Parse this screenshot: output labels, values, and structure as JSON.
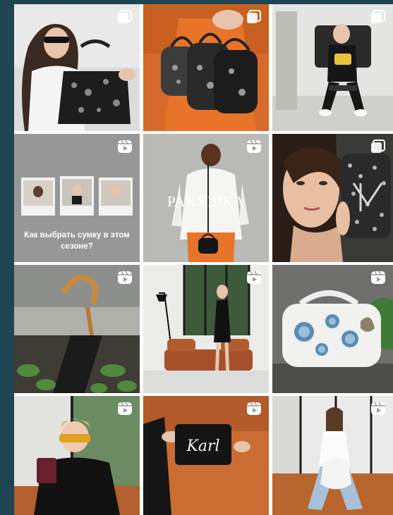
{
  "feed": {
    "tiles": [
      {
        "type": "carousel",
        "icon": "carousel-icon"
      },
      {
        "type": "carousel",
        "icon": "carousel-icon"
      },
      {
        "type": "carousel",
        "icon": "carousel-icon"
      },
      {
        "type": "reel",
        "icon": "reels-icon",
        "caption": "Как выбрать сумку в этом сезоне?"
      },
      {
        "type": "reel",
        "icon": "reels-icon",
        "overlay_text": "РАКУШКА"
      },
      {
        "type": "carousel",
        "icon": "carousel-icon"
      },
      {
        "type": "reel",
        "icon": "reels-icon"
      },
      {
        "type": "reel",
        "icon": "reels-icon"
      },
      {
        "type": "reel",
        "icon": "reels-icon"
      },
      {
        "type": "reel",
        "icon": "reels-icon"
      },
      {
        "type": "reel",
        "icon": "reels-icon",
        "bag_text": "Karl"
      },
      {
        "type": "reel",
        "icon": "reels-icon"
      }
    ]
  },
  "colors": {
    "page_background": "#1f4452",
    "accent_orange": "#e8742a",
    "leather_brown": "#a5502a"
  }
}
